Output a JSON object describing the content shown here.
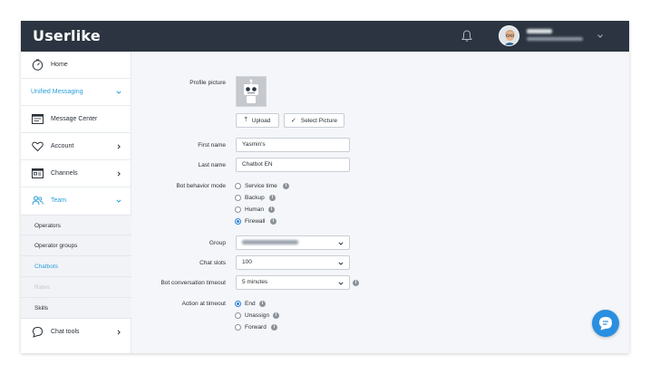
{
  "app": {
    "logo_text": "Userlike"
  },
  "topbar": {
    "icons": [
      "bell-icon",
      "chevron-down-icon"
    ]
  },
  "sidebar": {
    "items": [
      {
        "label": "Home",
        "icon": "dashboard-icon"
      },
      {
        "label": "Unified Messaging",
        "icon": "chevron-down-icon",
        "active": true
      },
      {
        "label": "Message Center",
        "icon": "message-center-icon"
      },
      {
        "label": "Account",
        "icon": "heart-icon"
      },
      {
        "label": "Channels",
        "icon": "channels-icon"
      },
      {
        "label": "Team",
        "icon": "team-icon",
        "active": true
      },
      {
        "label": "Chat tools",
        "icon": "chat-bubble-icon"
      }
    ],
    "team_sub": [
      {
        "label": "Operators"
      },
      {
        "label": "Operator groups"
      },
      {
        "label": "Chatbots",
        "active": true
      },
      {
        "label": "Rates",
        "disabled": true
      },
      {
        "label": "Skills"
      }
    ]
  },
  "form": {
    "profile_picture_label": "Profile picture",
    "upload_label": "Upload",
    "select_picture_label": "Select Picture",
    "first_name_label": "First name",
    "first_name_value": "Yasmin's",
    "last_name_label": "Last name",
    "last_name_value": "Chatbot EN",
    "bot_behavior_label": "Bot behavior mode",
    "bot_behavior_options": [
      "Service time",
      "Backup",
      "Human",
      "Firewall"
    ],
    "bot_behavior_selected": "Firewall",
    "group_label": "Group",
    "chat_slots_label": "Chat slots",
    "chat_slots_value": "100",
    "timeout_label": "Bot conversation timeout",
    "timeout_value": "5 minutes",
    "action_label": "Action at timeout",
    "action_options": [
      "End",
      "Unassign",
      "Forward"
    ],
    "action_selected": "End"
  },
  "colors": {
    "topbar": "#2b3440",
    "accent": "#2a9fd8",
    "fab": "#2a8fe0"
  }
}
